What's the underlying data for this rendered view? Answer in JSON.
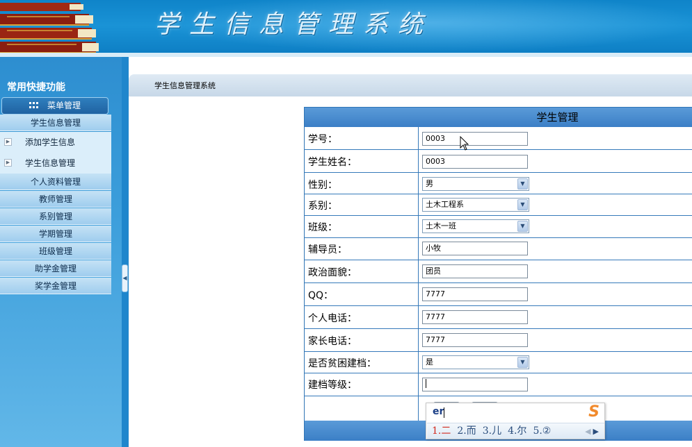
{
  "header": {
    "app_title": "学生信息管理系统"
  },
  "sidebar": {
    "title": "常用快捷功能",
    "menu_head": "菜单管理",
    "items": [
      {
        "label": "学生信息管理",
        "type": "section"
      },
      {
        "label": "添加学生信息",
        "type": "sub"
      },
      {
        "label": "学生信息管理",
        "type": "sub"
      },
      {
        "label": "个人资料管理",
        "type": "section"
      },
      {
        "label": "教师管理",
        "type": "section"
      },
      {
        "label": "系别管理",
        "type": "section"
      },
      {
        "label": "学期管理",
        "type": "section"
      },
      {
        "label": "班级管理",
        "type": "section"
      },
      {
        "label": "助学金管理",
        "type": "section"
      },
      {
        "label": "奖学金管理",
        "type": "section"
      }
    ]
  },
  "breadcrumb": "学生信息管理系统",
  "form": {
    "title": "学生管理",
    "fields": [
      {
        "label": "学号：",
        "value": "0003",
        "kind": "text"
      },
      {
        "label": "学生姓名：",
        "value": "0003",
        "kind": "text"
      },
      {
        "label": "性别：",
        "value": "男",
        "kind": "select"
      },
      {
        "label": "系别：",
        "value": "土木工程系",
        "kind": "select"
      },
      {
        "label": "班级：",
        "value": "土木一班",
        "kind": "select"
      },
      {
        "label": "辅导员：",
        "value": "小牧",
        "kind": "text"
      },
      {
        "label": "政治面貌：",
        "value": "团员",
        "kind": "text"
      },
      {
        "label": "QQ：",
        "value": "7777",
        "kind": "text"
      },
      {
        "label": "个人电话：",
        "value": "7777",
        "kind": "text"
      },
      {
        "label": "家长电话：",
        "value": "7777",
        "kind": "text"
      },
      {
        "label": "是否贫困建档：",
        "value": "是",
        "kind": "select"
      },
      {
        "label": "建档等级：",
        "value": "",
        "kind": "text"
      }
    ]
  },
  "ime": {
    "input": "er",
    "candidates": [
      "1.二",
      "2.而",
      "3.儿",
      "4.尔",
      "5.②"
    ],
    "logo": "S"
  },
  "colors": {
    "header_blue": "#1a93d6",
    "table_border": "#3579ba",
    "candidate_highlight": "#d22a1e"
  }
}
